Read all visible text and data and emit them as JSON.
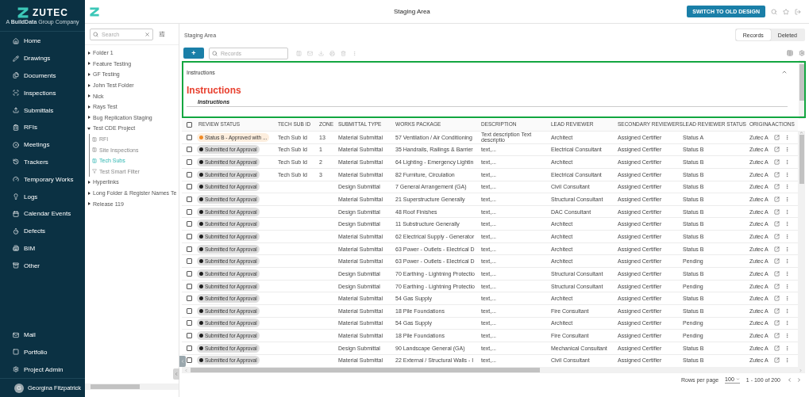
{
  "sidebar": {
    "logo": {
      "name": "ZUTEC",
      "tagline": "A **BuildData** Group Company"
    },
    "nav": [
      {
        "label": "Home"
      },
      {
        "label": "Drawings"
      },
      {
        "label": "Documents"
      },
      {
        "label": "Inspections"
      },
      {
        "label": "Submittals"
      },
      {
        "label": "RFIs"
      },
      {
        "label": "Meetings"
      },
      {
        "label": "Trackers"
      },
      {
        "label": "Temporary Works"
      },
      {
        "label": "Logs"
      },
      {
        "label": "Calendar Events"
      },
      {
        "label": "Defects"
      },
      {
        "label": "BIM"
      },
      {
        "label": "Other"
      }
    ],
    "bottom_nav": [
      {
        "label": "Mail"
      },
      {
        "label": "Portfolio"
      },
      {
        "label": "Project Admin"
      }
    ],
    "user": {
      "initial": "G",
      "name": "Georgina Fitzpatrick"
    }
  },
  "header": {
    "title": "Staging Area",
    "switch_button": "SWITCH TO OLD DESIGN"
  },
  "tree": {
    "search": {
      "placeholder": "Search"
    },
    "items": [
      {
        "label": "Folder 1",
        "expanded": false
      },
      {
        "label": "Feature Testing",
        "expanded": false
      },
      {
        "label": "GF Testing",
        "expanded": false
      },
      {
        "label": "John Test Folder",
        "expanded": false
      },
      {
        "label": "Nick",
        "expanded": false
      },
      {
        "label": "Rays Test",
        "expanded": false
      },
      {
        "label": "Bug Replication Staging",
        "expanded": false
      },
      {
        "label": "Test CDE Project",
        "expanded": true,
        "children": [
          {
            "label": "RFI",
            "kind": "register",
            "selected": false
          },
          {
            "label": "Site Inspections",
            "kind": "register",
            "selected": false
          },
          {
            "label": "Tech Subs",
            "kind": "register",
            "selected": true
          },
          {
            "label": "Test Smart Filter",
            "kind": "filter",
            "selected": false
          }
        ]
      },
      {
        "label": "Hyperlinks",
        "expanded": false
      },
      {
        "label": "Long Folder & Register Names Te",
        "expanded": false
      },
      {
        "label": "Release 119",
        "expanded": false
      }
    ]
  },
  "breadcrumb": "Staging Area",
  "view_tabs": [
    {
      "label": "Records",
      "selected": true
    },
    {
      "label": "Deleted",
      "selected": false
    }
  ],
  "toolbar": {
    "add_button": "+",
    "search": {
      "placeholder": "Records"
    }
  },
  "instructions": {
    "title": "Instructions",
    "expanded": true,
    "heading": "Instructions",
    "subheading": "Instructions"
  },
  "table": {
    "select_all": {
      "checked": false
    },
    "columns": [
      "REVIEW STATUS",
      "TECH SUB ID",
      "ZONE",
      "SUBMITTAL TYPE",
      "WORKS PACKAGE",
      "DESCRIPTION",
      "LEAD REVIEWER",
      "SECONDARY REVIEWERS",
      "LEAD REVIEWER STATUS",
      "ORIGINA",
      "ACTIONS"
    ],
    "rows": [
      {
        "selected": false,
        "review_status": {
          "label": "Status B - Approved with ...",
          "color": "#f08a24"
        },
        "tech_sub_id": "Tech Sub Id",
        "zone": "13",
        "submittal_type": "Material Submittal",
        "works_package": "57 Ventilation / Air Conditioning",
        "description": "Text description Text descriptio",
        "lead_reviewer": "Architect",
        "secondary_reviewers": "Assigned Certifier",
        "lead_reviewer_status": "Status A",
        "originator": "Zutec A"
      },
      {
        "selected": false,
        "review_status": {
          "label": "Submitted for Approval",
          "color": "#1e1e1e"
        },
        "tech_sub_id": "Tech Sub Id",
        "zone": "1",
        "submittal_type": "Material Submittal",
        "works_package": "35 Handrails, Railings & Barrier",
        "description": "text,...",
        "lead_reviewer": "Electrical Consultant",
        "secondary_reviewers": "Assigned Certifier",
        "lead_reviewer_status": "Status B",
        "originator": "Zutec A"
      },
      {
        "selected": false,
        "review_status": {
          "label": "Submitted for Approval",
          "color": "#1e1e1e"
        },
        "tech_sub_id": "Tech Sub Id",
        "zone": "2",
        "submittal_type": "Material Submittal",
        "works_package": "64 Lighting - Emergency Lightin",
        "description": "text,...",
        "lead_reviewer": "Architect",
        "secondary_reviewers": "Assigned Certifier",
        "lead_reviewer_status": "Status B",
        "originator": "Zutec A"
      },
      {
        "selected": false,
        "review_status": {
          "label": "Submitted for Approval",
          "color": "#1e1e1e"
        },
        "tech_sub_id": "Tech Sub Id",
        "zone": "3",
        "submittal_type": "Material Submittal",
        "works_package": "82 Furniture, Circulation",
        "description": "text,...",
        "lead_reviewer": "Electrical Consultant",
        "secondary_reviewers": "Assigned Certifier",
        "lead_reviewer_status": "Status B",
        "originator": "Zutec A"
      },
      {
        "selected": false,
        "review_status": {
          "label": "Submitted for Approval",
          "color": "#1e1e1e"
        },
        "submittal_type": "Design Submittal",
        "works_package": "7 General Arrangement (GA)",
        "description": "text,...",
        "lead_reviewer": "Civil Consultant",
        "secondary_reviewers": "Assigned Certifier",
        "lead_reviewer_status": "Status B",
        "originator": "Zutec A"
      },
      {
        "selected": false,
        "review_status": {
          "label": "Submitted for Approval",
          "color": "#1e1e1e"
        },
        "submittal_type": "Material Submittal",
        "works_package": "21 Superstructure Generally",
        "description": "text,...",
        "lead_reviewer": "Structural Consultant",
        "secondary_reviewers": "Assigned Certifier",
        "lead_reviewer_status": "Status B",
        "originator": "Zutec A"
      },
      {
        "selected": false,
        "review_status": {
          "label": "Submitted for Approval",
          "color": "#1e1e1e"
        },
        "submittal_type": "Design Submittal",
        "works_package": "48 Roof Finishes",
        "description": "text,...",
        "lead_reviewer": "DAC Consultant",
        "secondary_reviewers": "Assigned Certifier",
        "lead_reviewer_status": "Status B",
        "originator": "Zutec A"
      },
      {
        "selected": false,
        "review_status": {
          "label": "Submitted for Approval",
          "color": "#1e1e1e"
        },
        "submittal_type": "Design Submittal",
        "works_package": "11 Substructure Generally",
        "description": "text,...",
        "lead_reviewer": "Architect",
        "secondary_reviewers": "Assigned Certifier",
        "lead_reviewer_status": "Status B",
        "originator": "Zutec A"
      },
      {
        "selected": false,
        "review_status": {
          "label": "Submitted for Approval",
          "color": "#1e1e1e"
        },
        "submittal_type": "Material Submittal",
        "works_package": "62 Electrical Supply - Generator",
        "description": "text,...",
        "lead_reviewer": "Architect",
        "secondary_reviewers": "Assigned Certifier",
        "lead_reviewer_status": "Status B",
        "originator": "Zutec A"
      },
      {
        "selected": false,
        "review_status": {
          "label": "Submitted for Approval",
          "color": "#1e1e1e"
        },
        "submittal_type": "Material Submittal",
        "works_package": "63 Power - Outlets - Electrical D",
        "description": "text,...",
        "lead_reviewer": "Architect",
        "secondary_reviewers": "Assigned Certifier",
        "lead_reviewer_status": "Status B",
        "originator": "Zutec A"
      },
      {
        "selected": false,
        "review_status": {
          "label": "Submitted for Approval",
          "color": "#1e1e1e"
        },
        "submittal_type": "Material Submittal",
        "works_package": "63 Power - Outlets - Electrical D",
        "description": "text,...",
        "lead_reviewer": "Architect",
        "secondary_reviewers": "Assigned Certifier",
        "lead_reviewer_status": "Pending",
        "originator": "Zutec A"
      },
      {
        "selected": false,
        "review_status": {
          "label": "Submitted for Approval",
          "color": "#1e1e1e"
        },
        "submittal_type": "Design Submittal",
        "works_package": "70 Earthing - Lightning Protectio",
        "description": "text,...",
        "lead_reviewer": "Structural Consultant",
        "secondary_reviewers": "Assigned Certifier",
        "lead_reviewer_status": "Status B",
        "originator": "Zutec A"
      },
      {
        "selected": false,
        "review_status": {
          "label": "Submitted for Approval",
          "color": "#1e1e1e"
        },
        "submittal_type": "Design Submittal",
        "works_package": "70 Earthing - Lightning Protectio",
        "description": "text,...",
        "lead_reviewer": "Structural Consultant",
        "secondary_reviewers": "Assigned Certifier",
        "lead_reviewer_status": "Pending",
        "originator": "Zutec A"
      },
      {
        "selected": false,
        "review_status": {
          "label": "Submitted for Approval",
          "color": "#1e1e1e"
        },
        "submittal_type": "Material Submittal",
        "works_package": "54 Gas Supply",
        "description": "text,...",
        "lead_reviewer": "Architect",
        "secondary_reviewers": "Assigned Certifier",
        "lead_reviewer_status": "Status B",
        "originator": "Zutec A"
      },
      {
        "selected": false,
        "review_status": {
          "label": "Submitted for Approval",
          "color": "#1e1e1e"
        },
        "submittal_type": "Material Submittal",
        "works_package": "18 Pile Foundations",
        "description": "text,...",
        "lead_reviewer": "Fire Consultant",
        "secondary_reviewers": "Assigned Certifier",
        "lead_reviewer_status": "Status B",
        "originator": "Zutec A"
      },
      {
        "selected": false,
        "review_status": {
          "label": "Submitted for Approval",
          "color": "#1e1e1e"
        },
        "submittal_type": "Material Submittal",
        "works_package": "54 Gas Supply",
        "description": "text,...",
        "lead_reviewer": "Architect",
        "secondary_reviewers": "Assigned Certifier",
        "lead_reviewer_status": "Pending",
        "originator": "Zutec A"
      },
      {
        "selected": false,
        "review_status": {
          "label": "Submitted for Approval",
          "color": "#1e1e1e"
        },
        "submittal_type": "Material Submittal",
        "works_package": "18 Pile Foundations",
        "description": "text,...",
        "lead_reviewer": "Fire Consultant",
        "secondary_reviewers": "Assigned Certifier",
        "lead_reviewer_status": "Pending",
        "originator": "Zutec A"
      },
      {
        "selected": false,
        "review_status": {
          "label": "Submitted for Approval",
          "color": "#1e1e1e"
        },
        "submittal_type": "Design Submittal",
        "works_package": "90 Landscape General (GA)",
        "description": "text,...",
        "lead_reviewer": "Mechanical Consultant",
        "secondary_reviewers": "Assigned Certifier",
        "lead_reviewer_status": "Status B",
        "originator": "Zutec A"
      },
      {
        "selected": false,
        "review_status": {
          "label": "Submitted for Approval",
          "color": "#1e1e1e"
        },
        "submittal_type": "Material Submittal",
        "works_package": "22 External / Structural Walls - I",
        "description": "text,...",
        "lead_reviewer": "Civil Consultant",
        "secondary_reviewers": "Assigned Certifier",
        "lead_reviewer_status": "Status B",
        "originator": "Zutec A"
      }
    ]
  },
  "pagination": {
    "rows_per_page_label": "Rows per page",
    "rows_per_page": "100",
    "range": "1 - 100 of 200"
  }
}
